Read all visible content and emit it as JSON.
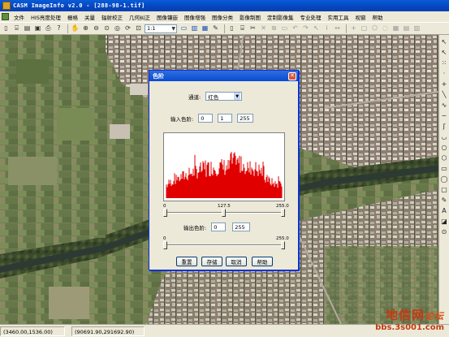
{
  "window": {
    "title": "CASM ImageInfo v2.0  - [288-98-1.tif]"
  },
  "menu": {
    "items": [
      "文件",
      "HIS亮度处理",
      "栅格",
      "关量",
      "辐射校正",
      "几何纠正",
      "图像镶嵌",
      "图像增强",
      "图像分类",
      "影像制图",
      "定制影像集",
      "专业处理",
      "实用工具",
      "视窗",
      "帮助"
    ]
  },
  "toolbar": {
    "zoom_value": "1:1"
  },
  "dialog": {
    "title": "色阶",
    "channel_label": "通道:",
    "channel_value": "红色",
    "input_levels_label": "输入色阶:",
    "input_levels": [
      "0",
      "1",
      "255"
    ],
    "input_ticks": [
      "0",
      "127.5",
      "255.0"
    ],
    "output_levels_label": "输出色阶:",
    "output_levels": [
      "0",
      "255"
    ],
    "output_ticks": [
      "0",
      "255.0"
    ],
    "buttons": {
      "reset": "重置",
      "save": "存储",
      "cancel": "取消",
      "help": "帮助"
    },
    "histogram_color": "#e00000"
  },
  "status": {
    "pixel_coords": "(3460.00,1536.00)",
    "geo_coords": "(90691.90,291692.90)"
  },
  "watermark": {
    "line1": "地信网",
    "line1_suffix": "论坛",
    "line2": "bbs.3s001.com"
  }
}
